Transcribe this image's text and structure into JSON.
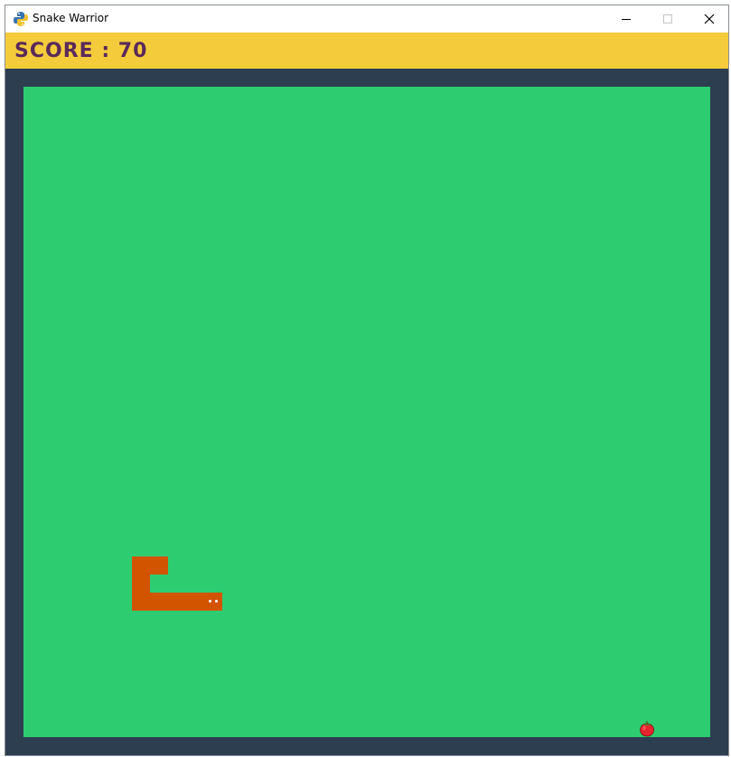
{
  "window": {
    "title": "Snake Warrior"
  },
  "score": {
    "text": "SCORE : 70",
    "value": 70
  },
  "colors": {
    "frame": "#2c3e50",
    "board": "#2ecc71",
    "scorebar": "#f4cb3b",
    "score_text": "#5a2a5a",
    "snake": "#d35400",
    "apple": "#e8242f"
  },
  "icons": {
    "app": "python-icon",
    "minimize": "minimize-icon",
    "maximize": "maximize-icon",
    "close": "close-icon",
    "food": "apple-icon"
  }
}
